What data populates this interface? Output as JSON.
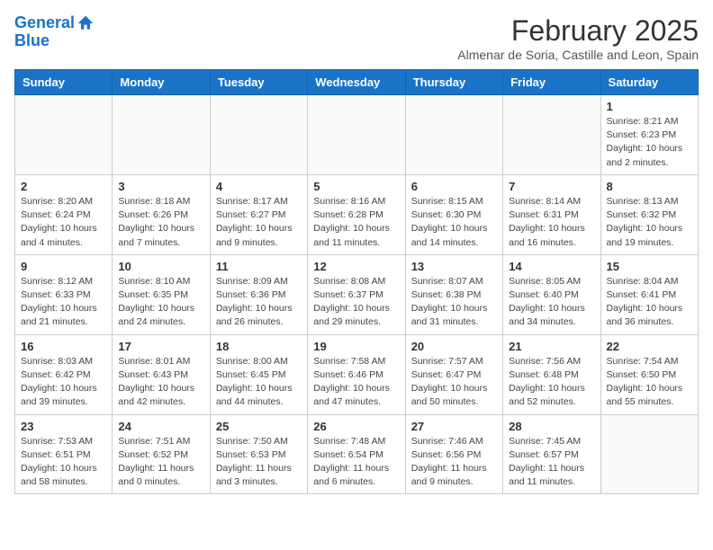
{
  "header": {
    "logo_line1": "General",
    "logo_line2": "Blue",
    "month": "February 2025",
    "location": "Almenar de Soria, Castille and Leon, Spain"
  },
  "weekdays": [
    "Sunday",
    "Monday",
    "Tuesday",
    "Wednesday",
    "Thursday",
    "Friday",
    "Saturday"
  ],
  "weeks": [
    [
      {
        "day": "",
        "info": ""
      },
      {
        "day": "",
        "info": ""
      },
      {
        "day": "",
        "info": ""
      },
      {
        "day": "",
        "info": ""
      },
      {
        "day": "",
        "info": ""
      },
      {
        "day": "",
        "info": ""
      },
      {
        "day": "1",
        "info": "Sunrise: 8:21 AM\nSunset: 6:23 PM\nDaylight: 10 hours and 2 minutes."
      }
    ],
    [
      {
        "day": "2",
        "info": "Sunrise: 8:20 AM\nSunset: 6:24 PM\nDaylight: 10 hours and 4 minutes."
      },
      {
        "day": "3",
        "info": "Sunrise: 8:18 AM\nSunset: 6:26 PM\nDaylight: 10 hours and 7 minutes."
      },
      {
        "day": "4",
        "info": "Sunrise: 8:17 AM\nSunset: 6:27 PM\nDaylight: 10 hours and 9 minutes."
      },
      {
        "day": "5",
        "info": "Sunrise: 8:16 AM\nSunset: 6:28 PM\nDaylight: 10 hours and 11 minutes."
      },
      {
        "day": "6",
        "info": "Sunrise: 8:15 AM\nSunset: 6:30 PM\nDaylight: 10 hours and 14 minutes."
      },
      {
        "day": "7",
        "info": "Sunrise: 8:14 AM\nSunset: 6:31 PM\nDaylight: 10 hours and 16 minutes."
      },
      {
        "day": "8",
        "info": "Sunrise: 8:13 AM\nSunset: 6:32 PM\nDaylight: 10 hours and 19 minutes."
      }
    ],
    [
      {
        "day": "9",
        "info": "Sunrise: 8:12 AM\nSunset: 6:33 PM\nDaylight: 10 hours and 21 minutes."
      },
      {
        "day": "10",
        "info": "Sunrise: 8:10 AM\nSunset: 6:35 PM\nDaylight: 10 hours and 24 minutes."
      },
      {
        "day": "11",
        "info": "Sunrise: 8:09 AM\nSunset: 6:36 PM\nDaylight: 10 hours and 26 minutes."
      },
      {
        "day": "12",
        "info": "Sunrise: 8:08 AM\nSunset: 6:37 PM\nDaylight: 10 hours and 29 minutes."
      },
      {
        "day": "13",
        "info": "Sunrise: 8:07 AM\nSunset: 6:38 PM\nDaylight: 10 hours and 31 minutes."
      },
      {
        "day": "14",
        "info": "Sunrise: 8:05 AM\nSunset: 6:40 PM\nDaylight: 10 hours and 34 minutes."
      },
      {
        "day": "15",
        "info": "Sunrise: 8:04 AM\nSunset: 6:41 PM\nDaylight: 10 hours and 36 minutes."
      }
    ],
    [
      {
        "day": "16",
        "info": "Sunrise: 8:03 AM\nSunset: 6:42 PM\nDaylight: 10 hours and 39 minutes."
      },
      {
        "day": "17",
        "info": "Sunrise: 8:01 AM\nSunset: 6:43 PM\nDaylight: 10 hours and 42 minutes."
      },
      {
        "day": "18",
        "info": "Sunrise: 8:00 AM\nSunset: 6:45 PM\nDaylight: 10 hours and 44 minutes."
      },
      {
        "day": "19",
        "info": "Sunrise: 7:58 AM\nSunset: 6:46 PM\nDaylight: 10 hours and 47 minutes."
      },
      {
        "day": "20",
        "info": "Sunrise: 7:57 AM\nSunset: 6:47 PM\nDaylight: 10 hours and 50 minutes."
      },
      {
        "day": "21",
        "info": "Sunrise: 7:56 AM\nSunset: 6:48 PM\nDaylight: 10 hours and 52 minutes."
      },
      {
        "day": "22",
        "info": "Sunrise: 7:54 AM\nSunset: 6:50 PM\nDaylight: 10 hours and 55 minutes."
      }
    ],
    [
      {
        "day": "23",
        "info": "Sunrise: 7:53 AM\nSunset: 6:51 PM\nDaylight: 10 hours and 58 minutes."
      },
      {
        "day": "24",
        "info": "Sunrise: 7:51 AM\nSunset: 6:52 PM\nDaylight: 11 hours and 0 minutes."
      },
      {
        "day": "25",
        "info": "Sunrise: 7:50 AM\nSunset: 6:53 PM\nDaylight: 11 hours and 3 minutes."
      },
      {
        "day": "26",
        "info": "Sunrise: 7:48 AM\nSunset: 6:54 PM\nDaylight: 11 hours and 6 minutes."
      },
      {
        "day": "27",
        "info": "Sunrise: 7:46 AM\nSunset: 6:56 PM\nDaylight: 11 hours and 9 minutes."
      },
      {
        "day": "28",
        "info": "Sunrise: 7:45 AM\nSunset: 6:57 PM\nDaylight: 11 hours and 11 minutes."
      },
      {
        "day": "",
        "info": ""
      }
    ]
  ]
}
